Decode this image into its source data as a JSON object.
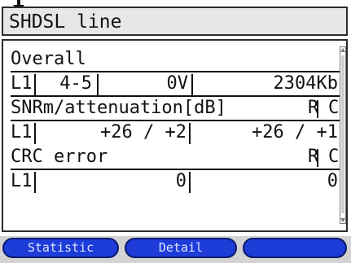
{
  "header": {
    "title": "SHDSL line",
    "top_icon": "arrow-down-icon"
  },
  "overall": {
    "heading": "Overall",
    "line": "L1",
    "pair": "4-5",
    "voltage": "0V",
    "rate": "2304Kb"
  },
  "snr": {
    "heading": "SNRm/attenuation[dB]",
    "col_r": "R",
    "col_c": "C",
    "line": "L1",
    "r_value": "+26 / +2",
    "c_value": "+26 / +1"
  },
  "crc": {
    "heading": "CRC error",
    "col_r": "R",
    "col_c": "C",
    "line": "L1",
    "r_value": "0",
    "c_value": "0"
  },
  "softkeys": [
    {
      "label": "Statistic"
    },
    {
      "label": "Detail"
    },
    {
      "label": ""
    }
  ],
  "colors": {
    "softkey_fill": "#1d3cd8",
    "softkey_text": "#dfe6ff",
    "title_bg": "#e7e7e7",
    "softkey_bar_bg": "#d3d3d3"
  }
}
